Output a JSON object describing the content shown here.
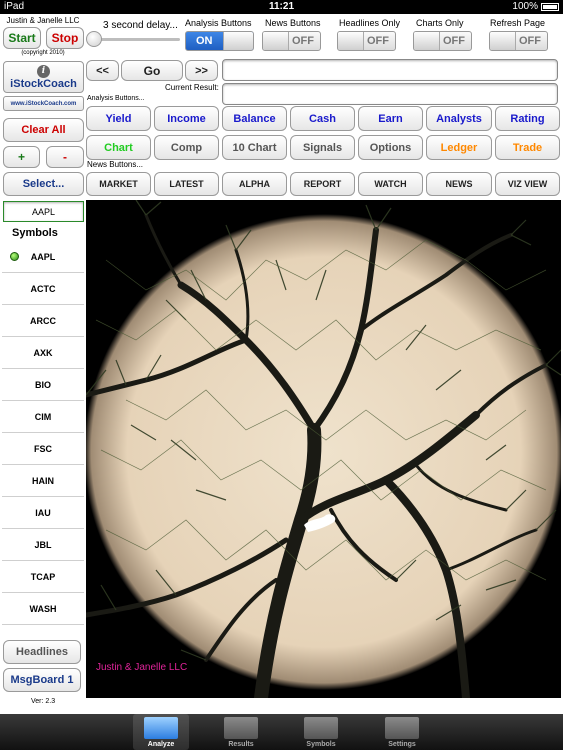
{
  "status_bar": {
    "carrier": "iPad",
    "time": "11:21",
    "battery": "100%"
  },
  "header": {
    "company": "Justin & Janelle LLC",
    "copyright": "(copyright 2010)",
    "start_label": "Start",
    "stop_label": "Stop",
    "delay_label": "3 second delay...",
    "slider_level": 0
  },
  "toggles": [
    {
      "title": "Analysis Buttons",
      "state": "ON"
    },
    {
      "title": "News Buttons",
      "state": "OFF"
    },
    {
      "title": "Headlines Only",
      "state": "OFF"
    },
    {
      "title": "Charts Only",
      "state": "OFF"
    },
    {
      "title": "Refresh Page",
      "state": "OFF"
    }
  ],
  "nav": {
    "prev": "<<",
    "go": "Go",
    "next": ">>",
    "current_result_label": "Current Result:"
  },
  "sidebar": {
    "brand": "iStockCoach",
    "website": "www.iStockCoach.com",
    "clear_all": "Clear All",
    "plus": "+",
    "minus": "-",
    "select": "Select...",
    "symbol_input": "AAPL",
    "symbols_heading": "Symbols",
    "symbols": [
      "AAPL",
      "ACTC",
      "ARCC",
      "AXK",
      "BIO",
      "CIM",
      "FSC",
      "HAIN",
      "IAU",
      "JBL",
      "TCAP",
      "WASH"
    ],
    "headlines": "Headlines",
    "msgboard": "MsgBoard 1",
    "version": "Ver: 2.3"
  },
  "analysis": {
    "label": "Analysis Buttons...",
    "row1": [
      "Yield",
      "Income",
      "Balance",
      "Cash",
      "Earn",
      "Analysts",
      "Rating"
    ],
    "row2": [
      "Chart",
      "Comp",
      "10 Chart",
      "Signals",
      "Options",
      "Ledger",
      "Trade"
    ]
  },
  "news": {
    "label": "News Buttons...",
    "buttons": [
      "MARKET",
      "LATEST",
      "ALPHA",
      "REPORT",
      "WATCH",
      "NEWS",
      "VIZ VIEW"
    ]
  },
  "image": {
    "caption": "Justin & Janelle LLC"
  },
  "tabs": [
    "Analyze",
    "Results",
    "Symbols",
    "Settings"
  ],
  "colors": {
    "blue": "#1a1acc",
    "green": "#22cc22",
    "orange": "#ff8800",
    "red": "#cc0000",
    "dark_green": "#1a7a1a",
    "gray": "#555555"
  }
}
